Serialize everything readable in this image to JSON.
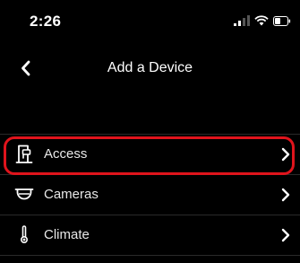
{
  "status_bar": {
    "time": "2:26",
    "icons": [
      "signal-icon",
      "wifi-icon",
      "battery-icon"
    ]
  },
  "nav": {
    "back_icon": "chevron-left-icon",
    "title": "Add a Device"
  },
  "list": {
    "items": [
      {
        "label": "Access",
        "icon": "door-access-icon",
        "highlighted": true
      },
      {
        "label": "Cameras",
        "icon": "camera-icon",
        "highlighted": false
      },
      {
        "label": "Climate",
        "icon": "thermometer-icon",
        "highlighted": false
      }
    ]
  },
  "colors": {
    "background": "#000000",
    "text": "#ffffff",
    "highlight": "#e0141c"
  }
}
